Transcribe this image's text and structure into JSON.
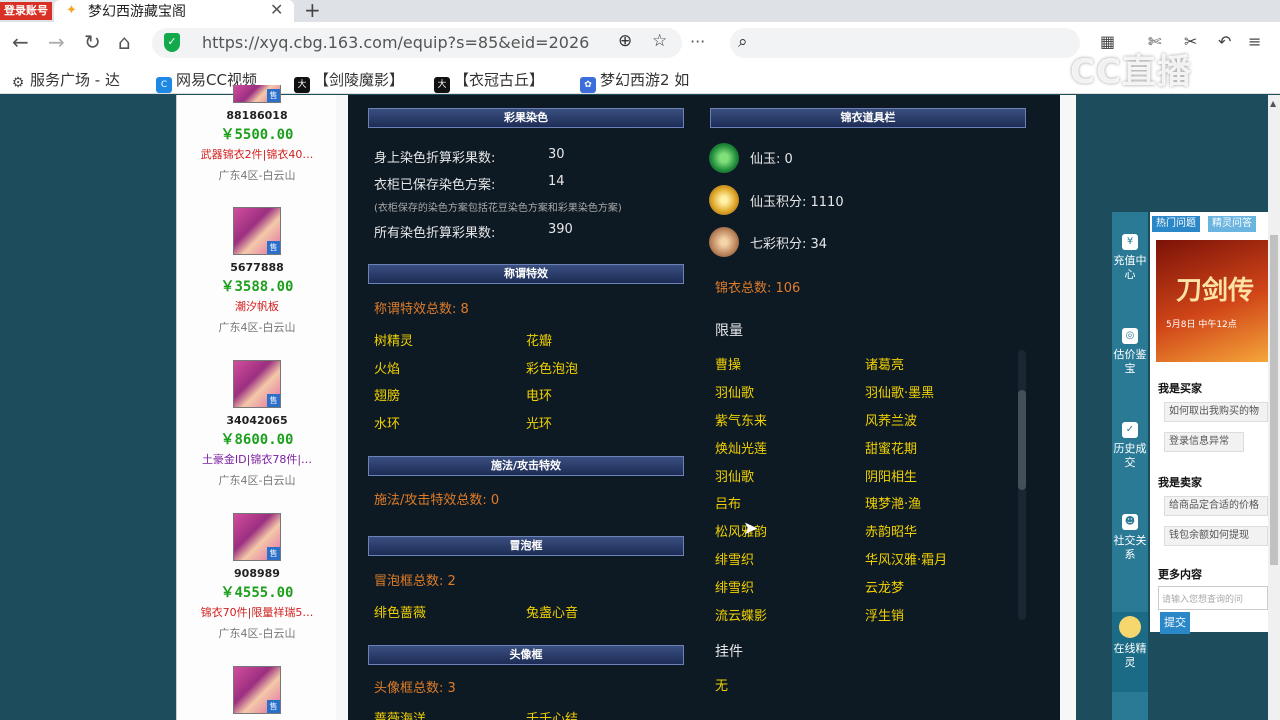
{
  "browser": {
    "login_badge": "登录账号",
    "tab_title": "梦幻西游藏宝阁",
    "close": "✕",
    "new_tab": "+",
    "url": "https://xyq.cbg.163.com/equip?s=85&eid=2026",
    "bookmarks": [
      "服务广场 - 达",
      "网易CC视频",
      "【剑陵魔影】",
      "【衣冠古丘】",
      "梦幻西游2 如"
    ],
    "watermark": "CC直播"
  },
  "sellers": [
    {
      "id": "88186018",
      "price": "￥5500.00",
      "tag": "武器锦衣2件|锦衣40…",
      "server": "广东4区-白云山"
    },
    {
      "id": "5677888",
      "price": "￥3588.00",
      "tag": "潮汐帆板",
      "server": "广东4区-白云山"
    },
    {
      "id": "34042065",
      "price": "￥8600.00",
      "tag": "土豪金ID|锦衣78件|…",
      "server": "广东4区-白云山"
    },
    {
      "id": "908989",
      "price": "￥4555.00",
      "tag": "锦衣70件|限量祥瑞5…",
      "server": "广东4区-白云山"
    }
  ],
  "sell_badge": "售",
  "sections": {
    "dye": {
      "title": "彩果染色",
      "row1_label": "身上染色折算彩果数:",
      "row1_value": "30",
      "row2_label": "衣柜已保存染色方案:",
      "row2_value": "14",
      "note": "(衣柜保存的染色方案包括花豆染色方案和彩果染色方案)",
      "row3_label": "所有染色折算彩果数:",
      "row3_value": "390"
    },
    "title_effect": {
      "title": "称谓特效",
      "total": "称谓特效总数: 8",
      "items": [
        "树精灵",
        "花瓣",
        "火焰",
        "彩色泡泡",
        "翅膀",
        "电环",
        "水环",
        "光环"
      ]
    },
    "spell_effect": {
      "title": "施法/攻击特效",
      "total": "施法/攻击特效总数: 0"
    },
    "bubble": {
      "title": "冒泡框",
      "total": "冒泡框总数: 2",
      "items": [
        "绯色蔷薇",
        "兔盏心音"
      ]
    },
    "avatar_frame": {
      "title": "头像框",
      "total": "头像框总数: 3",
      "items": [
        "蔷薇海洋",
        "千千心结"
      ]
    },
    "wardrobe": {
      "title": "锦衣道具栏",
      "xianyu": "仙玉: 0",
      "xianyu_points": "仙玉积分: 1110",
      "qicai_points": "七彩积分: 34",
      "total": "锦衣总数: 106",
      "limited_title": "限量",
      "limited_items": [
        "曹操",
        "诸葛亮",
        "羽仙歌",
        "羽仙歌·墨黑",
        "紫气东来",
        "风荞兰波",
        "焕灿光莲",
        "甜蜜花期",
        "羽仙歌",
        "阴阳相生",
        "吕布",
        "瑰梦滟·渔",
        "松风雅韵",
        "赤韵昭华",
        "绯雪织",
        "华风汉雅·霜月",
        "绯雪织",
        "云龙梦",
        "流云蝶影",
        "浮生销"
      ],
      "pendant_title": "挂件",
      "pendant_value": "无"
    }
  },
  "side_nav": [
    "充值中心",
    "估价鉴宝",
    "历史成交",
    "社交关系",
    "在线精灵"
  ],
  "help": {
    "tab_hot": "热门问题",
    "tab_other": "精灵问答",
    "banner_title": "刀剑传",
    "banner_sub": "5月8日 中午12点",
    "buyer_title": "我是买家",
    "buyer_q1": "如何取出我购买的物",
    "buyer_q2": "登录信息异常",
    "seller_title": "我是卖家",
    "seller_q1": "给商品定合适的价格",
    "seller_q2": "钱包余额如何提现",
    "more": "更多内容",
    "input_placeholder": "请输入您想查询的问",
    "submit": "提交"
  }
}
